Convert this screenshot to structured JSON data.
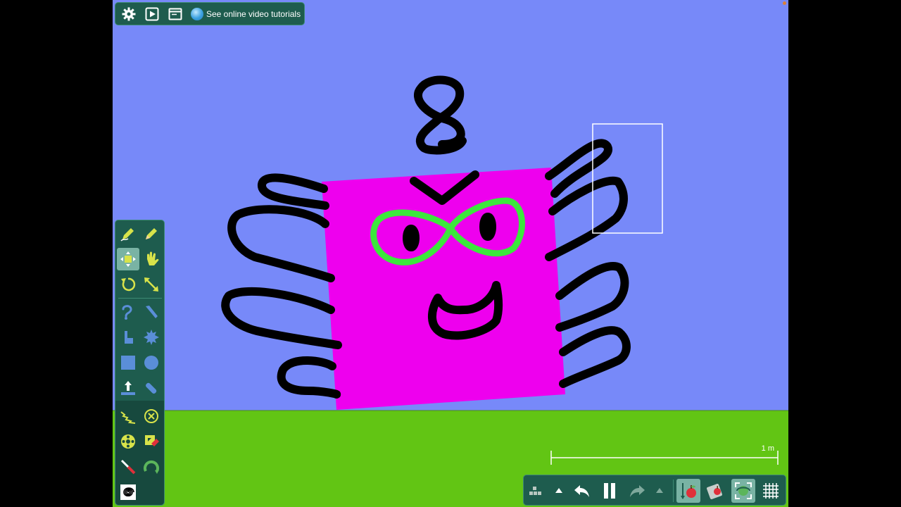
{
  "app": {
    "tutorials_link_label": "See online video tutorials",
    "scale_label": "1 m"
  },
  "top_toolbar": {
    "items": [
      {
        "name": "settings-button",
        "icon": "gear-icon"
      },
      {
        "name": "play-video-button",
        "icon": "play-square-icon"
      },
      {
        "name": "window-button",
        "icon": "window-icon"
      }
    ],
    "tutorials_icon": "globe-icon"
  },
  "tool_palette": {
    "tools": [
      {
        "name": "draw-tool",
        "icon": "pencil-scribble-icon"
      },
      {
        "name": "pen-tool",
        "icon": "pencil-icon"
      },
      {
        "name": "move-tool",
        "icon": "move-arrows-icon",
        "active": true
      },
      {
        "name": "drag-tool",
        "icon": "hand-icon"
      },
      {
        "name": "rotate-tool",
        "icon": "rotate-icon"
      },
      {
        "name": "scale-tool",
        "icon": "resize-arrows-icon"
      },
      {
        "name": "rope-tool",
        "icon": "rope-icon"
      },
      {
        "name": "knife-tool",
        "icon": "knife-icon"
      },
      {
        "name": "hinge-tool",
        "icon": "hinge-icon"
      },
      {
        "name": "gear-shape-tool",
        "icon": "gear-shape-icon"
      },
      {
        "name": "box-tool",
        "icon": "square-icon"
      },
      {
        "name": "circle-tool",
        "icon": "circle-icon"
      },
      {
        "name": "thruster-tool",
        "icon": "thruster-icon"
      },
      {
        "name": "tape-tool",
        "icon": "tape-icon"
      },
      {
        "name": "spring-tool",
        "icon": "spring-icon"
      },
      {
        "name": "remove-tool",
        "icon": "cross-circle-icon"
      },
      {
        "name": "wheel-tool",
        "icon": "wheel-icon"
      },
      {
        "name": "eraser-tool",
        "icon": "eraser-icon"
      },
      {
        "name": "weld-tool",
        "icon": "weld-icon"
      },
      {
        "name": "motor-tool",
        "icon": "motor-icon"
      },
      {
        "name": "hypno-tool",
        "icon": "spiral-icon"
      }
    ]
  },
  "bottom_toolbar": {
    "items": [
      {
        "name": "layers-button",
        "icon": "blocks-icon"
      },
      {
        "name": "undo-menu-button",
        "icon": "triangle-up-icon"
      },
      {
        "name": "undo-button",
        "icon": "undo-arrow-icon"
      },
      {
        "name": "pause-button",
        "icon": "pause-icon"
      },
      {
        "name": "redo-button",
        "icon": "redo-arrow-icon"
      },
      {
        "name": "redo-menu-button",
        "icon": "triangle-up-icon"
      },
      {
        "name": "gravity-button",
        "icon": "apple-gravity-icon"
      },
      {
        "name": "friction-button",
        "icon": "apple-box-icon"
      },
      {
        "name": "follow-camera-button",
        "icon": "camera-target-icon"
      },
      {
        "name": "grid-button",
        "icon": "grid-icon"
      }
    ]
  },
  "colors": {
    "sky": "#7789f9",
    "ground": "#62c514",
    "character_body": "#ee00ee",
    "glasses": "#3ce83c",
    "toolbar_bg": "#1e5c4e",
    "icon_yellow": "#d8e34a",
    "icon_blue": "#5a8ed8"
  }
}
